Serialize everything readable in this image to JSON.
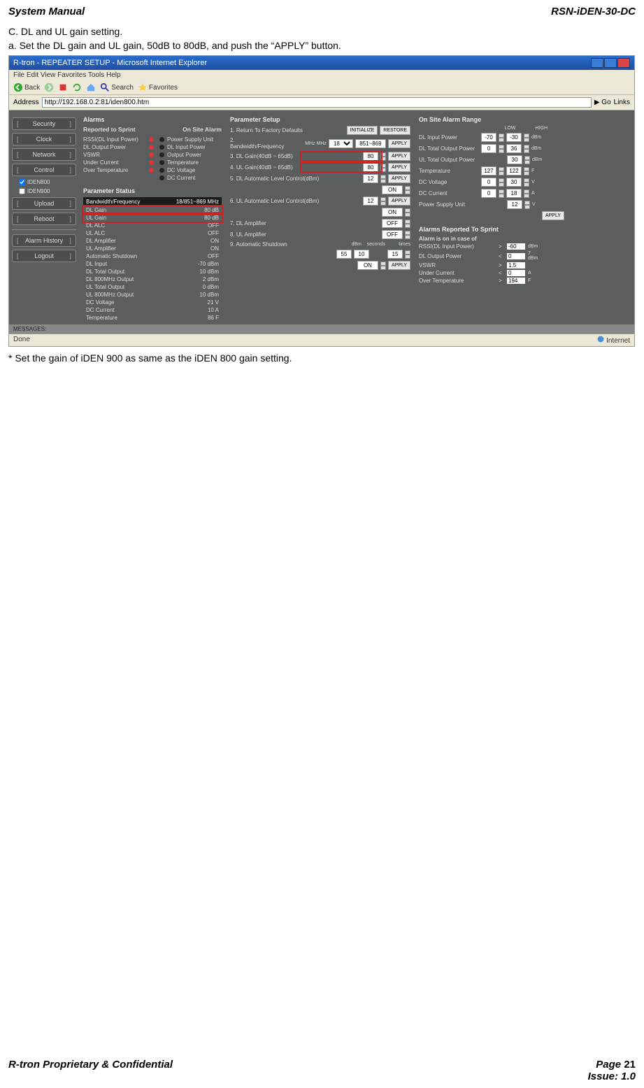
{
  "header": {
    "left": "System Manual",
    "right": "RSN-iDEN-30-DC"
  },
  "steps": {
    "c": "C. DL and UL gain setting.",
    "a": "a. Set the DL gain and UL gain, 50dB to 80dB, and push the “APPLY” button."
  },
  "browser": {
    "title": "R-tron - REPEATER SETUP - Microsoft Internet Explorer",
    "menu": "File  Edit  View  Favorites  Tools  Help",
    "toolbar": {
      "back": "Back",
      "search": "Search",
      "favorites": "Favorites"
    },
    "address_label": "Address",
    "address": "http://192.168.0.2:81/iden800.htm",
    "go": "Go",
    "links": "Links",
    "status_left": "Done",
    "status_right": "Internet"
  },
  "sidebar": {
    "items": [
      "Security",
      "Clock",
      "Network",
      "Control"
    ],
    "checks": [
      {
        "label": "IDEN800",
        "checked": true
      },
      {
        "label": "IDEN900",
        "checked": false
      }
    ],
    "items2": [
      "Upload",
      "Reboot"
    ],
    "items3": [
      "Alarm History",
      "Logout"
    ]
  },
  "alarms": {
    "title": "Alarms",
    "sub_left": "Reported to Sprint",
    "sub_right": "On Site Alarm",
    "rows": [
      {
        "l": "RSSI(DL Input Power)",
        "d1": "r",
        "d2": "k",
        "r": "Power Supply Unit"
      },
      {
        "l": "DL Output Power",
        "d1": "r",
        "d2": "k",
        "r": "DL Input Power"
      },
      {
        "l": "VSWR",
        "d1": "r",
        "d2": "k",
        "r": "Output Power"
      },
      {
        "l": "Under Current",
        "d1": "r",
        "d2": "k",
        "r": "Temperature"
      },
      {
        "l": "Over Temperature",
        "d1": "r",
        "d2": "k",
        "r": "DC Voltage"
      },
      {
        "l": "",
        "d1": "",
        "d2": "k",
        "r": "DC Current"
      }
    ]
  },
  "pstatus": {
    "title": "Parameter Status",
    "head": {
      "l": "Bandwidth/Frequency",
      "r": "18/851~869 MHz"
    },
    "rows": [
      {
        "l": "DL Gain",
        "r": "80 dB",
        "hl": true
      },
      {
        "l": "UL Gain",
        "r": "80 dB",
        "hl": true
      },
      {
        "l": "DL ALC",
        "r": "OFF"
      },
      {
        "l": "UL ALC",
        "r": "OFF"
      },
      {
        "l": "DL Amplifier",
        "r": "ON"
      },
      {
        "l": "UL Amplifier",
        "r": "ON"
      },
      {
        "l": "Automatic Shutdown",
        "r": "OFF"
      },
      {
        "l": "DL Input",
        "r": "-70 dBm"
      },
      {
        "l": "DL Total Output",
        "r": "10 dBm"
      },
      {
        "l": "DL 800MHz Output",
        "r": "2 dBm"
      },
      {
        "l": "UL Total Output",
        "r": "0 dBm"
      },
      {
        "l": "UL 800MHz Output",
        "r": "10 dBm"
      },
      {
        "l": "DC Voltage",
        "r": "21 V"
      },
      {
        "l": "DC Current",
        "r": "10 A"
      },
      {
        "l": "Temperature",
        "r": "86 F"
      }
    ]
  },
  "params": {
    "title": "Parameter Setup",
    "p1": {
      "label": "1. Return To Factory Defaults",
      "b1": "INITIALIZE",
      "b2": "RESTORE"
    },
    "p2": {
      "label": "2. Bandwidth/Frequency",
      "sub": "MHz               MHz",
      "v1": "18",
      "v2": "851~869",
      "btn": "APPLY"
    },
    "p3": {
      "label": "3. DL Gain(40dB ~ 65dB)",
      "v": "80",
      "btn": "APPLY"
    },
    "p4": {
      "label": "4. UL Gain(40dB ~ 65dB)",
      "v": "80",
      "btn": "APPLY"
    },
    "p5": {
      "label": "5. DL Automatic Level Control(dBm)",
      "v": "12",
      "btn": "APPLY",
      "on": "ON"
    },
    "p6": {
      "label": "6. UL Automatic Level Control(dBm)",
      "v": "12",
      "btn": "APPLY",
      "on": "ON"
    },
    "p7": {
      "label": "7. DL Amplifier",
      "v": "OFF"
    },
    "p8": {
      "label": "8. UL Amplifier",
      "v": "OFF"
    },
    "p9": {
      "label": "9. Automatic Shutdown",
      "hdr": "dBm    seconds          times",
      "v1": "55",
      "v2": "10",
      "v3": "15",
      "on": "ON",
      "btn": "APPLY"
    }
  },
  "range": {
    "title": "On Site Alarm Range",
    "low": "LOW",
    "high": "HIGH",
    "rows": [
      {
        "l": "DL Input Power",
        "lo": "-70",
        "hi": "-30",
        "u": "dBm"
      },
      {
        "l": "DL Total Output Power",
        "lo": "0",
        "hi": "36",
        "u": "dBm"
      },
      {
        "l": "UL Total Output Power",
        "lo": "",
        "hi": "30",
        "u": "dBm"
      },
      {
        "l": "Temperature",
        "lo": "127",
        "hi": "122",
        "u": "F"
      },
      {
        "l": "DC Voltage",
        "lo": "0",
        "hi": "30",
        "u": "V"
      },
      {
        "l": "DC Current",
        "lo": "0",
        "hi": "18",
        "u": "A"
      },
      {
        "l": "Power Supply Unit",
        "lo": "",
        "hi": "12",
        "u": "V"
      }
    ],
    "apply": "APPLY"
  },
  "sprint": {
    "title": "Alarms Reported To Sprint",
    "sub": "Alarm is on in case of",
    "rows": [
      {
        "l": "RSSI(DL Input Power)",
        "op": ">",
        "v": "-60",
        "u": "dBm"
      },
      {
        "l": "DL Output Power",
        "op": "<",
        "v": "0",
        "u": "7 dBm"
      },
      {
        "l": "VSWR",
        "op": ">",
        "v": "1.5",
        "u": ""
      },
      {
        "l": "Under Current",
        "op": "<",
        "v": "0",
        "u": "A"
      },
      {
        "l": "Over Temperature",
        "op": ">",
        "v": "194",
        "u": "F"
      }
    ]
  },
  "messages": "MESSAGES:",
  "footnote": "* Set the gain of iDEN 900 as same as the iDEN 800 gain setting.",
  "footer": {
    "left": "R-tron Proprietary & Confidential",
    "page": "Page 21",
    "issue": "Issue: 1.0"
  }
}
